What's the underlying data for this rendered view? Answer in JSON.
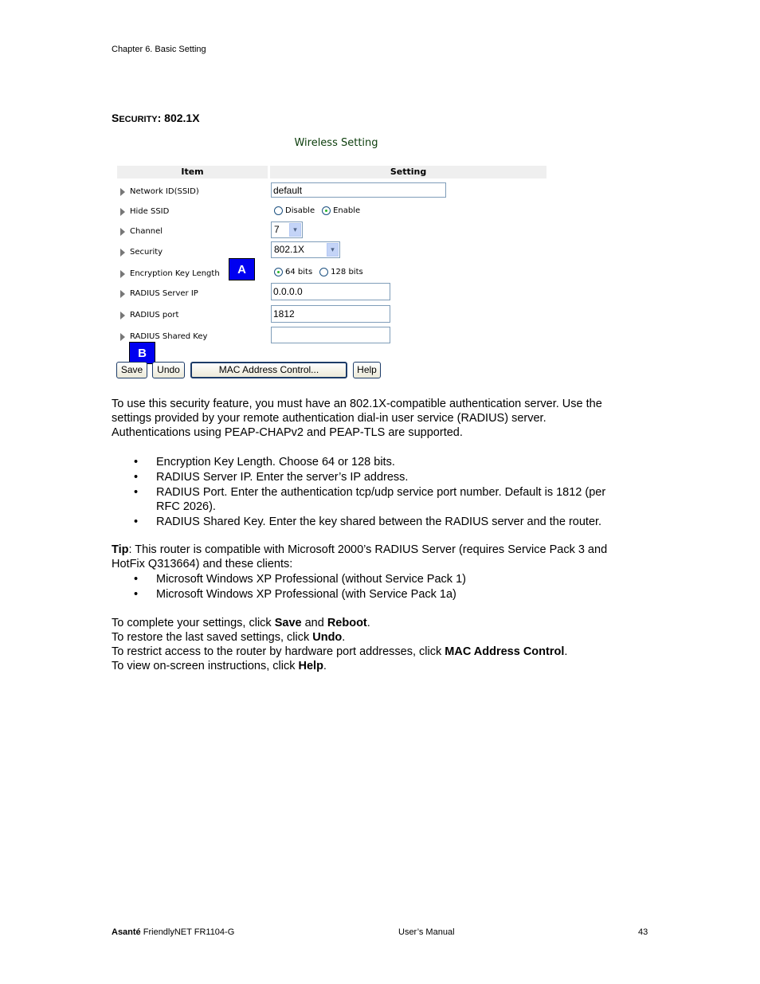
{
  "header": {
    "chapter": "Chapter 6. Basic Setting"
  },
  "section": {
    "title_cap": "S",
    "title_small": "ECURITY",
    "title_rest": ": 802.1X"
  },
  "panel": {
    "title": "Wireless Setting",
    "col_item": "Item",
    "col_setting": "Setting",
    "rows": [
      {
        "label": "Network ID(SSID)"
      },
      {
        "label": "Hide SSID"
      },
      {
        "label": "Channel"
      },
      {
        "label": "Security"
      },
      {
        "label": "Encryption Key Length"
      },
      {
        "label": "RADIUS Server IP"
      },
      {
        "label": "RADIUS port"
      },
      {
        "label": "RADIUS Shared Key"
      }
    ],
    "ssid_value": "default",
    "hide_ssid": {
      "disable": "Disable",
      "enable": "Enable",
      "selected": "Enable"
    },
    "channel": {
      "value": "7",
      "arrow": "▾"
    },
    "security": {
      "value": "802.1X"
    },
    "key_length": {
      "opt64": "64 bits",
      "opt128": "128 bits",
      "selected": "64 bits"
    },
    "radius_ip": "0.0.0.0",
    "radius_port": "1812",
    "radius_key": "",
    "badge_a": "A",
    "badge_b": "B",
    "buttons": {
      "save": "Save",
      "undo": "Undo",
      "mac": "MAC Address Control...",
      "help": "Help"
    }
  },
  "body": {
    "intro": [
      "To use this security feature, you must have an 802.1X-compatible authentication server. Use the",
      "settings provided by your remote authentication dial-in user service (RADIUS) server.",
      "Authentications using PEAP-CHAPv2 and PEAP-TLS are supported."
    ],
    "bullet_char": "•",
    "bullets": [
      "Encryption Key Length. Choose 64 or 128 bits.",
      "RADIUS Server IP. Enter the server’s IP address.",
      "RADIUS Port. Enter the authentication tcp/udp service port number. Default is 1812 (per",
      "RFC 2026).",
      "RADIUS Shared Key. Enter the key shared between the RADIUS server and the router."
    ],
    "tip_label": "Tip",
    "tip_line1": ": This router is compatible with Microsoft 2000’s RADIUS Server (requires Service Pack 3 and",
    "tip_line2": "HotFix Q313664) and these clients:",
    "tip_bullets": [
      "Microsoft Windows XP Professional (without Service Pack 1)",
      "Microsoft Windows XP Professional (with Service Pack 1a)"
    ],
    "instr": {
      "l1a": "To complete your settings, click ",
      "l1b": "Save",
      "l1c": " and ",
      "l1d": "Reboot",
      "l1e": ".",
      "l2a": "To restore the last saved settings, click ",
      "l2b": "Undo",
      "l2c": ".",
      "l3a": "To restrict access to the router by hardware port addresses, click ",
      "l3b": "MAC Address Control",
      "l3c": ".",
      "l4a": "To view on-screen instructions, click ",
      "l4b": "Help",
      "l4c": "."
    }
  },
  "footer": {
    "brand": "Asanté",
    "product": " FriendlyNET FR1104-G",
    "manual": "User’s Manual",
    "page": "43"
  }
}
